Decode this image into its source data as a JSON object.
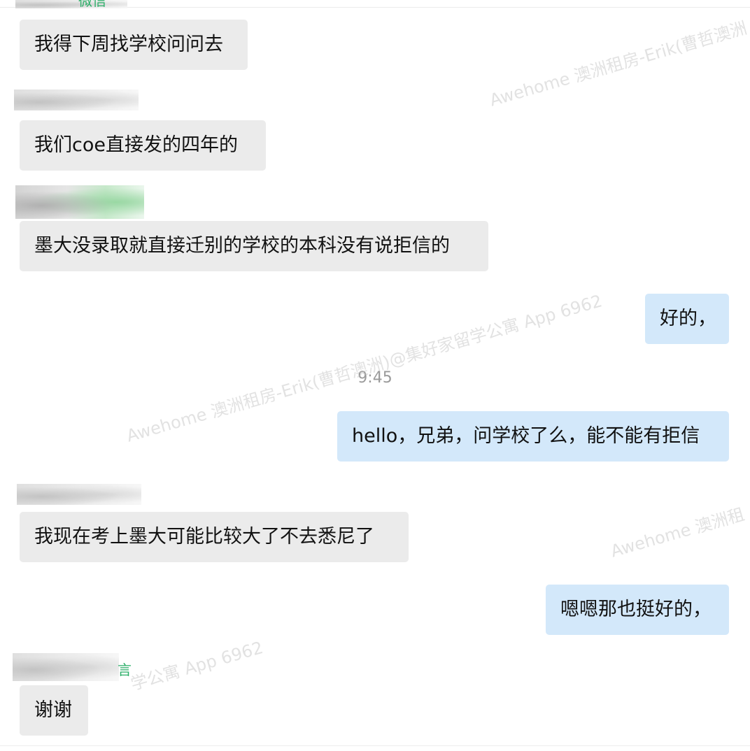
{
  "messages": [
    {
      "side": "in",
      "text": "我得下周找学校问问去"
    },
    {
      "side": "in",
      "text": "我们coe直接发的四年的"
    },
    {
      "side": "in",
      "text": "墨大没录取就直接迁别的学校的本科没有说拒信的"
    },
    {
      "side": "out",
      "text": "好的，"
    },
    {
      "side": "out",
      "text": "hello，兄弟，问学校了么，能不能有拒信"
    },
    {
      "side": "in",
      "text": "我现在考上墨大可能比较大了不去悉尼了"
    },
    {
      "side": "out",
      "text": "嗯嗯那也挺好的，"
    },
    {
      "side": "in",
      "text": "谢谢"
    }
  ],
  "timestamp": "9:45",
  "sender_tags": {
    "top": "微信",
    "bottom": "言"
  },
  "watermarks": {
    "w1": "Awehome 澳洲租房-Erik(曹哲澳洲",
    "w2": "Awehome 澳洲租房-Erik(曹哲澳洲)@集好家留学公寓 App 6962",
    "w3": "Awehome 澳洲租",
    "w4": "学公寓 App 6962"
  },
  "colors": {
    "incoming_bubble": "#ebebeb",
    "outgoing_bubble": "#d3e8fa",
    "sender_tag": "#2aae67"
  }
}
